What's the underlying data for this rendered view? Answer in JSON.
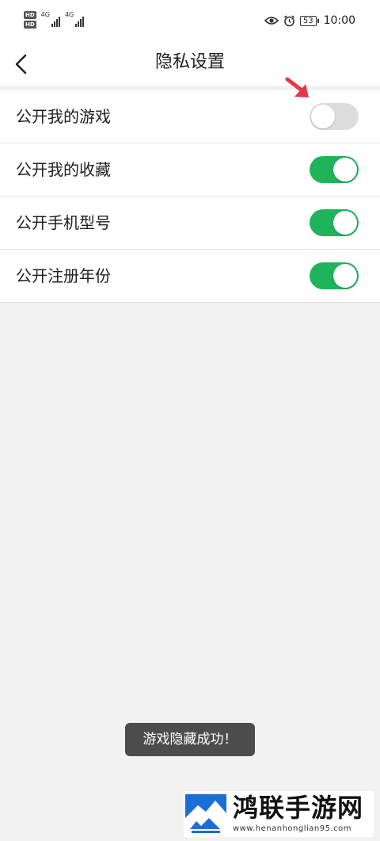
{
  "status_bar": {
    "hd_1": "HD",
    "hd_2": "HD",
    "signal_1_label": "4G",
    "signal_2_label": "4G",
    "battery": "53",
    "time": "10:00"
  },
  "header": {
    "title": "隐私设置"
  },
  "settings": [
    {
      "label": "公开我的游戏",
      "state": "off"
    },
    {
      "label": "公开我的收藏",
      "state": "on"
    },
    {
      "label": "公开手机型号",
      "state": "on"
    },
    {
      "label": "公开注册年份",
      "state": "on"
    }
  ],
  "toast": {
    "message": "游戏隐藏成功！"
  },
  "watermark": {
    "brand": "鸿联手游网",
    "url": "www.henanhonglian95.com"
  },
  "colors": {
    "toggle_on": "#1fb35a",
    "toggle_off": "#dcdcdc",
    "arrow": "#e03a4a",
    "toast_bg": "#4c4c4c",
    "page_bg": "#f2f2f2"
  },
  "icons": {
    "back": "chevron-left-icon",
    "arrow": "red-arrow-icon",
    "eye": "eye-icon",
    "alarm": "alarm-icon",
    "battery": "battery-icon"
  }
}
